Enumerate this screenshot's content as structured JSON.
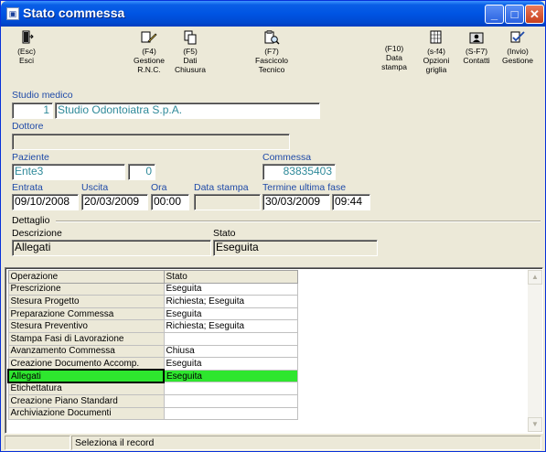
{
  "window": {
    "title": "Stato commessa",
    "minimize": "_",
    "maximize": "□",
    "close": "✕"
  },
  "toolbar": {
    "esc": {
      "key": "(Esc)",
      "label": "Esci",
      "icon": "exit-door-icon"
    },
    "f4": {
      "key": "(F4)",
      "label": "Gestione R.N.C.",
      "icon": "pencil-edit-icon"
    },
    "f5": {
      "key": "(F5)",
      "label": "Dati Chiusura",
      "icon": "copy-documents-icon"
    },
    "f7": {
      "key": "(F7)",
      "label": "Fascicolo Tecnico",
      "icon": "clipboard-search-icon"
    },
    "f10": {
      "key": "(F10)",
      "label": "Data stampa"
    },
    "sf4": {
      "key": "(s-f4)",
      "label": "Opzioni griglia",
      "icon": "grid-options-icon"
    },
    "sf7": {
      "key": "(S-F7)",
      "label": "Contatti",
      "icon": "contacts-icon"
    },
    "invio": {
      "key": "(Invio)",
      "label": "Gestione",
      "icon": "checkmark-edit-icon"
    }
  },
  "studio": {
    "label": "Studio medico",
    "code": "1",
    "name": "Studio Odontoiatra S.p.A."
  },
  "dottore": {
    "label": "Dottore",
    "value": ""
  },
  "paziente": {
    "label": "Paziente",
    "name": "Ente3",
    "code": "0"
  },
  "commessa": {
    "label": "Commessa",
    "value": "83835403"
  },
  "dates": {
    "entrata_label": "Entrata",
    "entrata": "09/10/2008",
    "uscita_label": "Uscita",
    "uscita": "20/03/2009",
    "ora_label": "Ora",
    "ora": "00:00",
    "data_stampa_label": "Data stampa",
    "data_stampa": "",
    "termine_label": "Termine ultima fase",
    "termine_data": "30/03/2009",
    "termine_ora": "09:44"
  },
  "dettaglio": {
    "legend": "Dettaglio",
    "descrizione_label": "Descrizione",
    "descrizione": "Allegati",
    "stato_label": "Stato",
    "stato": "Eseguita"
  },
  "grid": {
    "headers": [
      "Operazione",
      "Stato"
    ],
    "rows": [
      {
        "op": "Prescrizione",
        "stato": "Eseguita"
      },
      {
        "op": "Stesura Progetto",
        "stato": "Richiesta; Eseguita"
      },
      {
        "op": "Preparazione Commessa",
        "stato": "Eseguita"
      },
      {
        "op": "Stesura Preventivo",
        "stato": "Richiesta; Eseguita"
      },
      {
        "op": "Stampa Fasi di Lavorazione",
        "stato": ""
      },
      {
        "op": "Avanzamento Commessa",
        "stato": "Chiusa"
      },
      {
        "op": "Creazione Documento Accomp.",
        "stato": "Eseguita"
      },
      {
        "op": "Allegati",
        "stato": "Eseguita",
        "selected": true
      },
      {
        "op": "Etichettatura",
        "stato": ""
      },
      {
        "op": "Creazione Piano Standard",
        "stato": ""
      },
      {
        "op": "Archiviazione Documenti",
        "stato": ""
      }
    ],
    "selected_color": "#2ee62e"
  },
  "status": {
    "left": "",
    "message": "Seleziona il record"
  }
}
